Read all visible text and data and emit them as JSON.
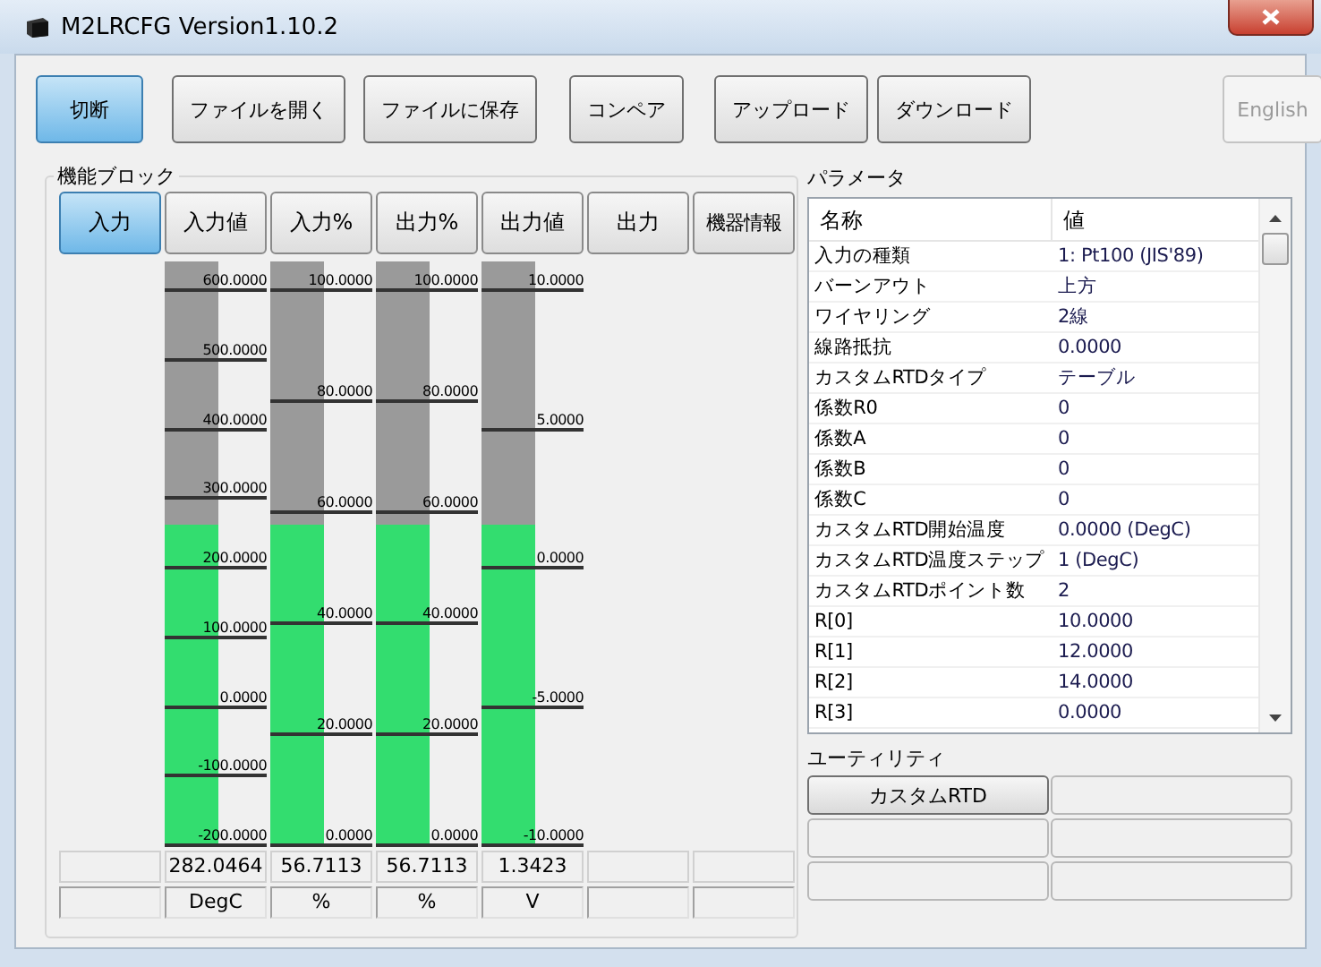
{
  "window": {
    "title": "M2LRCFG Version1.10.2"
  },
  "toolbar": [
    {
      "label": "切断",
      "selected": true,
      "disabled": false
    },
    {
      "label": "ファイルを開く",
      "selected": false,
      "disabled": false
    },
    {
      "label": "ファイルに保存",
      "selected": false,
      "disabled": false
    },
    {
      "label": "コンペア",
      "selected": false,
      "disabled": false
    },
    {
      "label": "アップロード",
      "selected": false,
      "disabled": false
    },
    {
      "label": "ダウンロード",
      "selected": false,
      "disabled": false
    },
    {
      "label": "English",
      "selected": false,
      "disabled": true
    }
  ],
  "function_block": {
    "title": "機能ブロック",
    "tabs": [
      {
        "label": "入力",
        "selected": true
      },
      {
        "label": "入力値",
        "selected": false
      },
      {
        "label": "入力%",
        "selected": false
      },
      {
        "label": "出力%",
        "selected": false
      },
      {
        "label": "出力値",
        "selected": false
      },
      {
        "label": "出力",
        "selected": false
      },
      {
        "label": "機器情報",
        "selected": false
      }
    ],
    "columns": [
      {
        "kind": "blank"
      },
      {
        "kind": "gauge",
        "level": 0.55,
        "ticks": [
          "600.0000",
          "500.0000",
          "400.0000",
          "300.0000",
          "200.0000",
          "100.0000",
          "0.0000",
          "-100.0000",
          "-200.0000"
        ],
        "reading": "282.0464",
        "unit": "DegC"
      },
      {
        "kind": "gauge",
        "level": 0.55,
        "ticks": [
          "100.0000",
          "80.0000",
          "60.0000",
          "40.0000",
          "20.0000",
          "0.0000"
        ],
        "reading": "56.7113",
        "unit": "%"
      },
      {
        "kind": "gauge",
        "level": 0.55,
        "ticks": [
          "100.0000",
          "80.0000",
          "60.0000",
          "40.0000",
          "20.0000",
          "0.0000"
        ],
        "reading": "56.7113",
        "unit": "%"
      },
      {
        "kind": "gauge",
        "level": 0.55,
        "ticks": [
          "10.0000",
          "5.0000",
          "0.0000",
          "-5.0000",
          "-10.0000"
        ],
        "reading": "1.3423",
        "unit": "V"
      },
      {
        "kind": "blank"
      },
      {
        "kind": "blank"
      }
    ]
  },
  "parameters": {
    "title": "パラメータ",
    "columns": [
      "名称",
      "値"
    ],
    "rows": [
      {
        "name": "入力の種類",
        "value": "1: Pt100 (JIS'89)"
      },
      {
        "name": "バーンアウト",
        "value": "上方"
      },
      {
        "name": "ワイヤリング",
        "value": "2線"
      },
      {
        "name": "線路抵抗",
        "value": "0.0000"
      },
      {
        "name": "カスタムRTDタイプ",
        "value": "テーブル"
      },
      {
        "name": "係数R0",
        "value": "0"
      },
      {
        "name": "係数A",
        "value": "0"
      },
      {
        "name": "係数B",
        "value": "0"
      },
      {
        "name": "係数C",
        "value": "0"
      },
      {
        "name": "カスタムRTD開始温度",
        "value": "0.0000 (DegC)"
      },
      {
        "name": "カスタムRTD温度ステップ",
        "value": "1 (DegC)"
      },
      {
        "name": "カスタムRTDポイント数",
        "value": "2"
      },
      {
        "name": "R[0]",
        "value": "10.0000"
      },
      {
        "name": "R[1]",
        "value": "12.0000"
      },
      {
        "name": "R[2]",
        "value": "14.0000"
      },
      {
        "name": "R[3]",
        "value": "0.0000"
      }
    ]
  },
  "utility": {
    "title": "ユーティリティ",
    "buttons": [
      {
        "kind": "button",
        "label": "カスタムRTD"
      },
      {
        "kind": "blank"
      },
      {
        "kind": "blank"
      },
      {
        "kind": "blank"
      },
      {
        "kind": "blank"
      },
      {
        "kind": "blank"
      }
    ]
  }
}
